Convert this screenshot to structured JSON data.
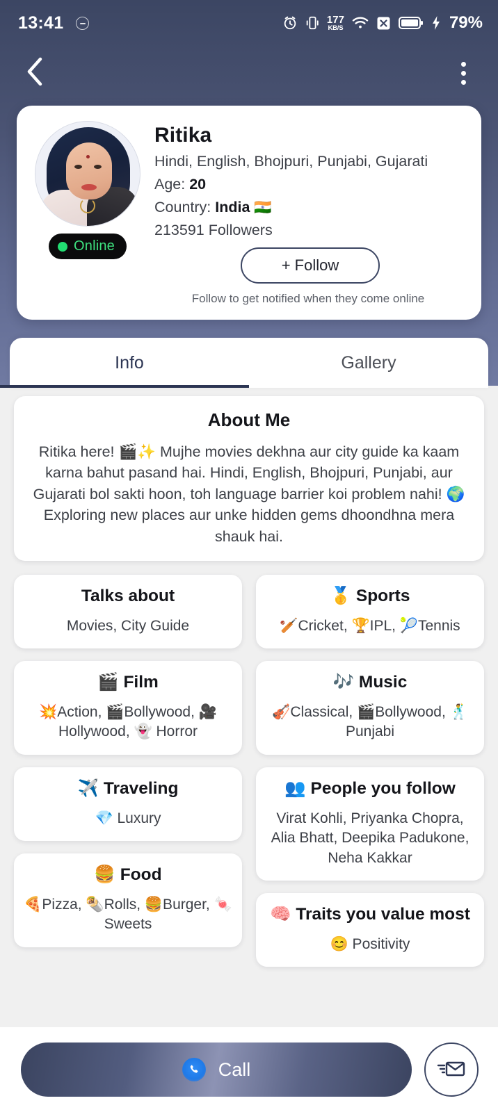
{
  "status_bar": {
    "time": "13:41",
    "net_speed_value": "177",
    "net_speed_unit": "KB/S",
    "battery_percent": "79%",
    "icons": [
      "alarm-icon",
      "vibrate-icon",
      "network-speed-icon",
      "wifi-icon",
      "sim-off-icon",
      "battery-icon",
      "charging-bolt-icon"
    ]
  },
  "nav": {
    "back_icon": "back-chevron-icon",
    "menu_icon": "three-dot-menu-icon"
  },
  "profile": {
    "name": "Ritika",
    "languages": "Hindi, English, Bhojpuri, Punjabi, Gujarati",
    "age_label": "Age:",
    "age_value": "20",
    "country_label": "Country:",
    "country_value": "India",
    "country_flag": "🇮🇳",
    "followers": "213591 Followers",
    "online_status": "Online",
    "follow_button": "+ Follow",
    "follow_hint": "Follow to get notified when they come online"
  },
  "tabs": [
    {
      "label": "Info",
      "active": true
    },
    {
      "label": "Gallery",
      "active": false
    }
  ],
  "about": {
    "title": "About Me",
    "text": "Ritika here! 🎬✨ Mujhe movies dekhna aur city guide ka kaam karna bahut pasand hai. Hindi, English, Bhojpuri, Punjabi, aur Gujarati bol sakti hoon, toh language barrier koi problem nahi! 🌍 Exploring new places aur unke hidden gems dhoondhna mera shauk hai."
  },
  "left_cards": [
    {
      "title": "Talks about",
      "body": "Movies, City Guide"
    },
    {
      "title": "🎬 Film",
      "body": "💥Action, 🎬Bollywood, 🎥Hollywood, 👻 Horror"
    },
    {
      "title": "✈️ Traveling",
      "body": "💎 Luxury"
    },
    {
      "title": "🍔 Food",
      "body": "🍕Pizza, 🌯Rolls, 🍔Burger, 🍬 Sweets"
    }
  ],
  "right_cards": [
    {
      "title": "🥇 Sports",
      "body": "🏏Cricket, 🏆IPL, 🎾Tennis"
    },
    {
      "title": "🎶 Music",
      "body": "🎻Classical, 🎬Bollywood, 🕺 Punjabi"
    },
    {
      "title": "👥 People you follow",
      "body": "Virat Kohli, Priyanka Chopra, Alia Bhatt, Deepika Padukone, Neha Kakkar"
    },
    {
      "title": "🧠 Traits you value most",
      "body": "😊 Positivity"
    }
  ],
  "bottom": {
    "call_label": "Call",
    "call_icon": "phone-icon",
    "message_icon": "envelope-send-icon"
  },
  "colors": {
    "header_top": "#3c4663",
    "header_bottom": "#707aa2",
    "accent": "#2c3553",
    "online_green": "#3ee07f",
    "page_bg": "#f0f0f0"
  }
}
